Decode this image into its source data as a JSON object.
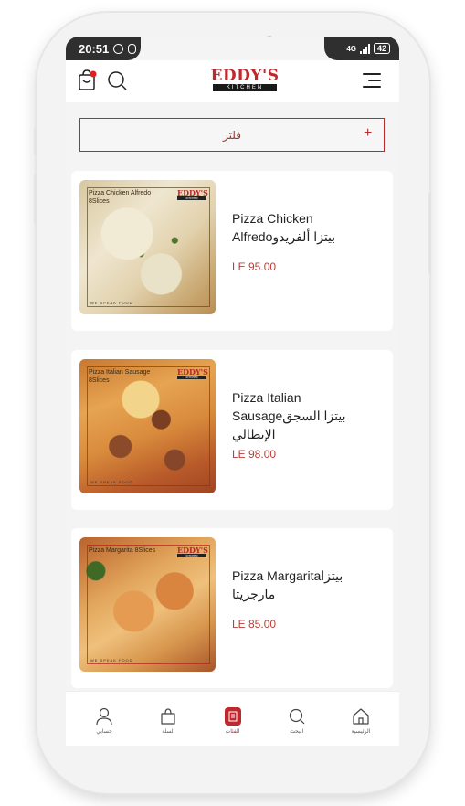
{
  "status_bar": {
    "time": "20:51",
    "network": "4G",
    "battery": "42"
  },
  "header": {
    "logo_main": "EDDY'S",
    "logo_sub": "KITCHEN"
  },
  "filter": {
    "label": "فلتر",
    "plus": "+"
  },
  "products": [
    {
      "name": "Pizza Chicken Alfredoبيتزا ألفريدو",
      "price": "LE 95.00",
      "image_caption": "Pizza Chicken Alfredo 8Slices",
      "image_brand": "EDDY'S",
      "image_brand_sub": "KITCHEN",
      "image_footer": "WE SPEAK FOOD"
    },
    {
      "name": "Pizza Italian Sausageبيتزا السجق الإيطالي",
      "price": "LE 98.00",
      "image_caption": "Pizza Italian Sausage 8Slices",
      "image_brand": "EDDY'S",
      "image_brand_sub": "KITCHEN",
      "image_footer": "WE SPEAK FOOD"
    },
    {
      "name": "Pizza Margaritaبيتزا مارجريتا",
      "price": "LE 85.00",
      "image_caption": "Pizza Margarita 8Slices",
      "image_brand": "EDDY'S",
      "image_brand_sub": "KITCHEN",
      "image_footer": "WE SPEAK FOOD"
    }
  ],
  "bottom_nav": {
    "account": "حسابي",
    "cart": "السلة",
    "categories": "الفئات",
    "search": "البحث",
    "home": "الرئيسية"
  },
  "colors": {
    "brand_red": "#c0282d",
    "price_red": "#b6403a",
    "background": "#f4f4f4"
  },
  "icons": [
    "shopping-bag-icon",
    "search-icon",
    "hamburger-menu-icon",
    "user-icon",
    "cart-icon",
    "categories-icon",
    "home-icon",
    "plus-icon"
  ]
}
